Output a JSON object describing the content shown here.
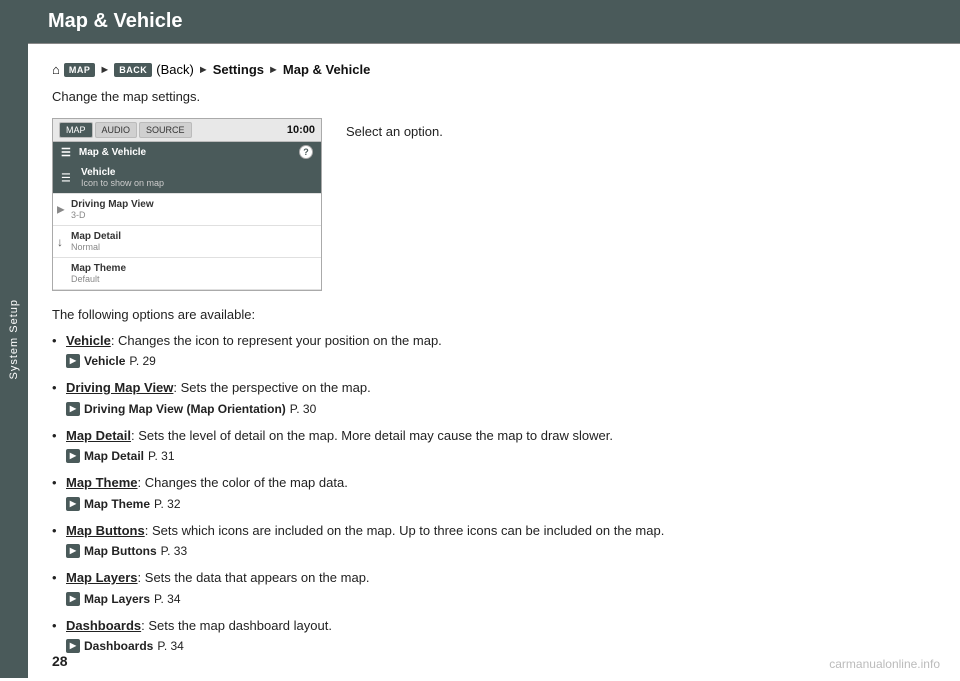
{
  "sidebar": {
    "label": "System Setup"
  },
  "header": {
    "title": "Map & Vehicle"
  },
  "breadcrumb": {
    "map_label": "MAP",
    "back_label": "BACK",
    "back_text": "(Back)",
    "arrow1": "►",
    "settings": "Settings",
    "arrow2": "►",
    "section": "Map & Vehicle"
  },
  "description": "Change the map settings.",
  "select_option": "Select an option.",
  "mockup": {
    "tabs": [
      "MAP",
      "AUDIO",
      "SOURCE"
    ],
    "time": "10:00",
    "title": "Map & Vehicle",
    "help": "?",
    "items": [
      {
        "name": "Vehicle",
        "sub": "Icon to show on map",
        "selected": true,
        "has_menu": true
      },
      {
        "name": "Driving Map View",
        "sub": "3-D",
        "selected": false,
        "has_arrow": true
      },
      {
        "name": "Map Detail",
        "sub": "Normal",
        "selected": false,
        "has_scroll": true
      },
      {
        "name": "Map Theme",
        "sub": "Default",
        "selected": false,
        "has_arrow": false
      }
    ]
  },
  "options_intro": "The following options are available:",
  "options": [
    {
      "name": "Vehicle",
      "colon": ":",
      "description": "Changes the icon to represent your position on the map.",
      "ref_label": "Vehicle",
      "ref_page": "P. 29"
    },
    {
      "name": "Driving Map View",
      "colon": ":",
      "description": "Sets the perspective on the map.",
      "ref_label": "Driving Map View (Map Orientation)",
      "ref_page": "P. 30"
    },
    {
      "name": "Map Detail",
      "colon": ":",
      "description": "Sets the level of detail on the map. More detail may cause the map to draw slower.",
      "ref_label": "Map Detail",
      "ref_page": "P. 31"
    },
    {
      "name": "Map Theme",
      "colon": ":",
      "description": "Changes the color of the map data.",
      "ref_label": "Map Theme",
      "ref_page": "P. 32"
    },
    {
      "name": "Map Buttons",
      "colon": ":",
      "description": "Sets which icons are included on the map. Up to three icons can be included on the map.",
      "ref_label": "Map Buttons",
      "ref_page": "P. 33"
    },
    {
      "name": "Map Layers",
      "colon": ":",
      "description": "Sets the data that appears on the map.",
      "ref_label": "Map Layers",
      "ref_page": "P. 34"
    },
    {
      "name": "Dashboards",
      "colon": ":",
      "description": "Sets the map dashboard layout.",
      "ref_label": "Dashboards",
      "ref_page": "P. 34"
    }
  ],
  "page_number": "28",
  "watermark": "carmanualonline.info"
}
